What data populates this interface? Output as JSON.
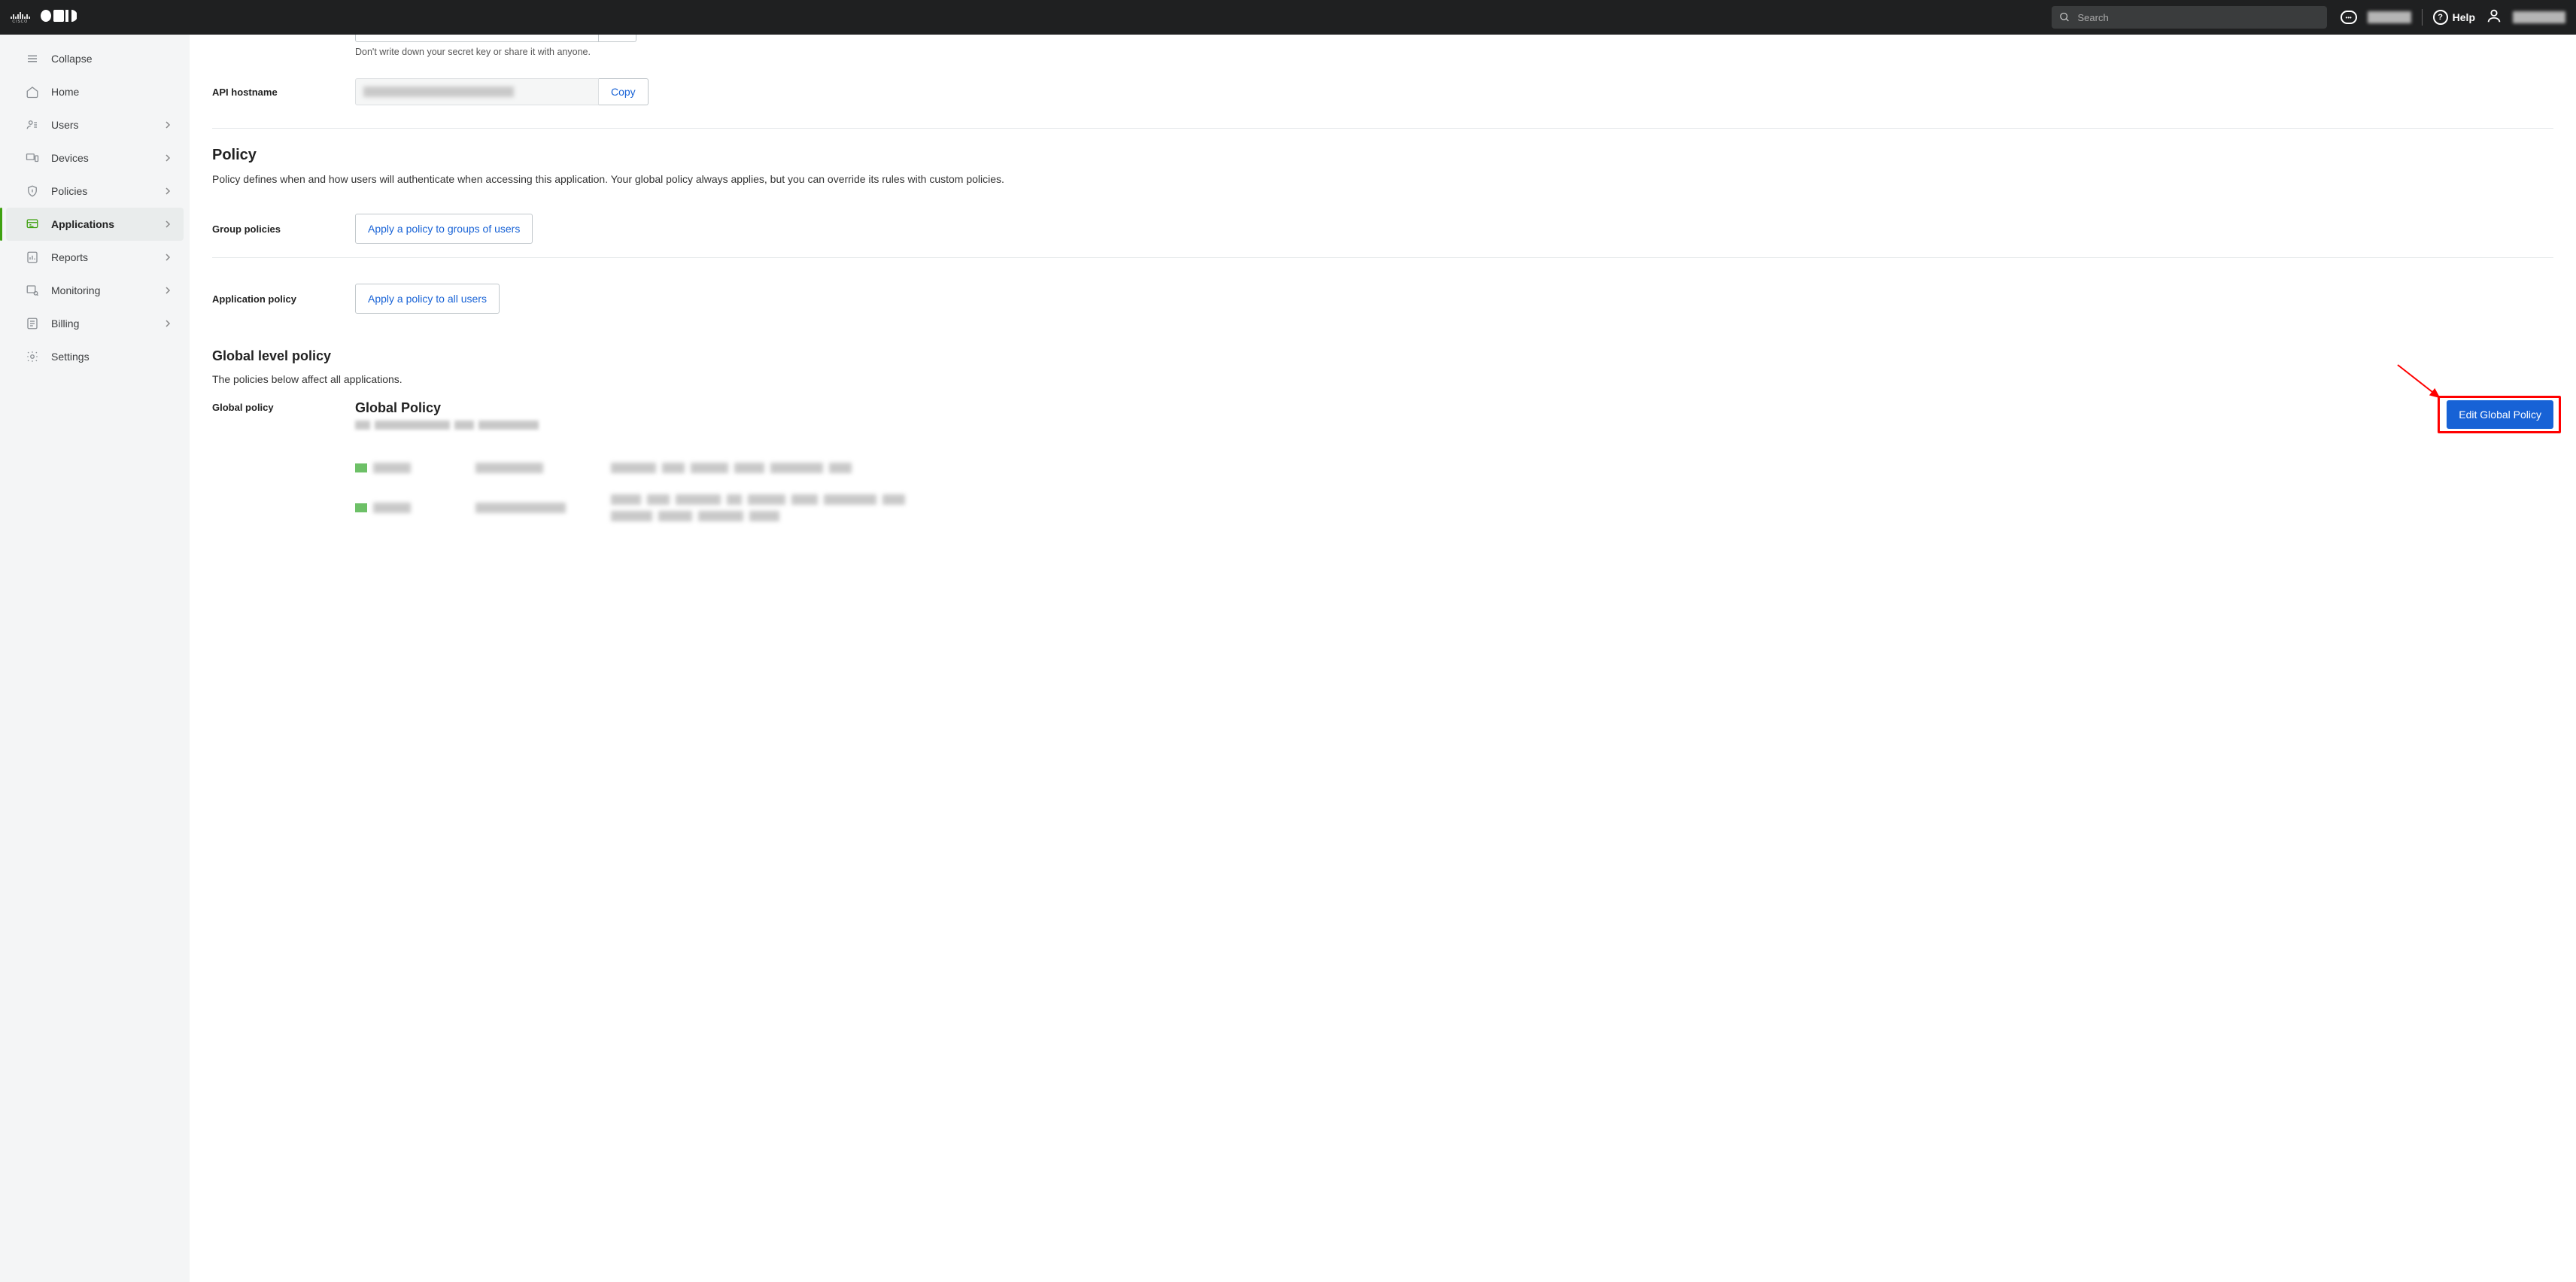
{
  "topbar": {
    "cisco_label": "CISCO",
    "duo_label": "DUO",
    "search_placeholder": "Search",
    "help_label": "Help"
  },
  "sidebar": {
    "collapse": "Collapse",
    "items": [
      {
        "label": "Home",
        "has_chevron": false
      },
      {
        "label": "Users",
        "has_chevron": true
      },
      {
        "label": "Devices",
        "has_chevron": true
      },
      {
        "label": "Policies",
        "has_chevron": true
      },
      {
        "label": "Applications",
        "has_chevron": true,
        "active": true
      },
      {
        "label": "Reports",
        "has_chevron": true
      },
      {
        "label": "Monitoring",
        "has_chevron": true
      },
      {
        "label": "Billing",
        "has_chevron": true
      },
      {
        "label": "Settings",
        "has_chevron": false
      }
    ]
  },
  "api_section": {
    "secret_hint": "Don't write down your secret key or share it with anyone.",
    "api_hostname_label": "API hostname",
    "copy_label": "Copy"
  },
  "policy_section": {
    "heading": "Policy",
    "description": "Policy defines when and how users will authenticate when accessing this application. Your global policy always applies, but you can override its rules with custom policies.",
    "group_policies_label": "Group policies",
    "group_apply_btn": "Apply a policy to groups of users",
    "app_policy_label": "Application policy",
    "app_apply_btn": "Apply a policy to all users"
  },
  "global_section": {
    "heading": "Global level policy",
    "description": "The policies below affect all applications.",
    "row_label": "Global policy",
    "title": "Global Policy",
    "edit_btn": "Edit Global Policy"
  }
}
